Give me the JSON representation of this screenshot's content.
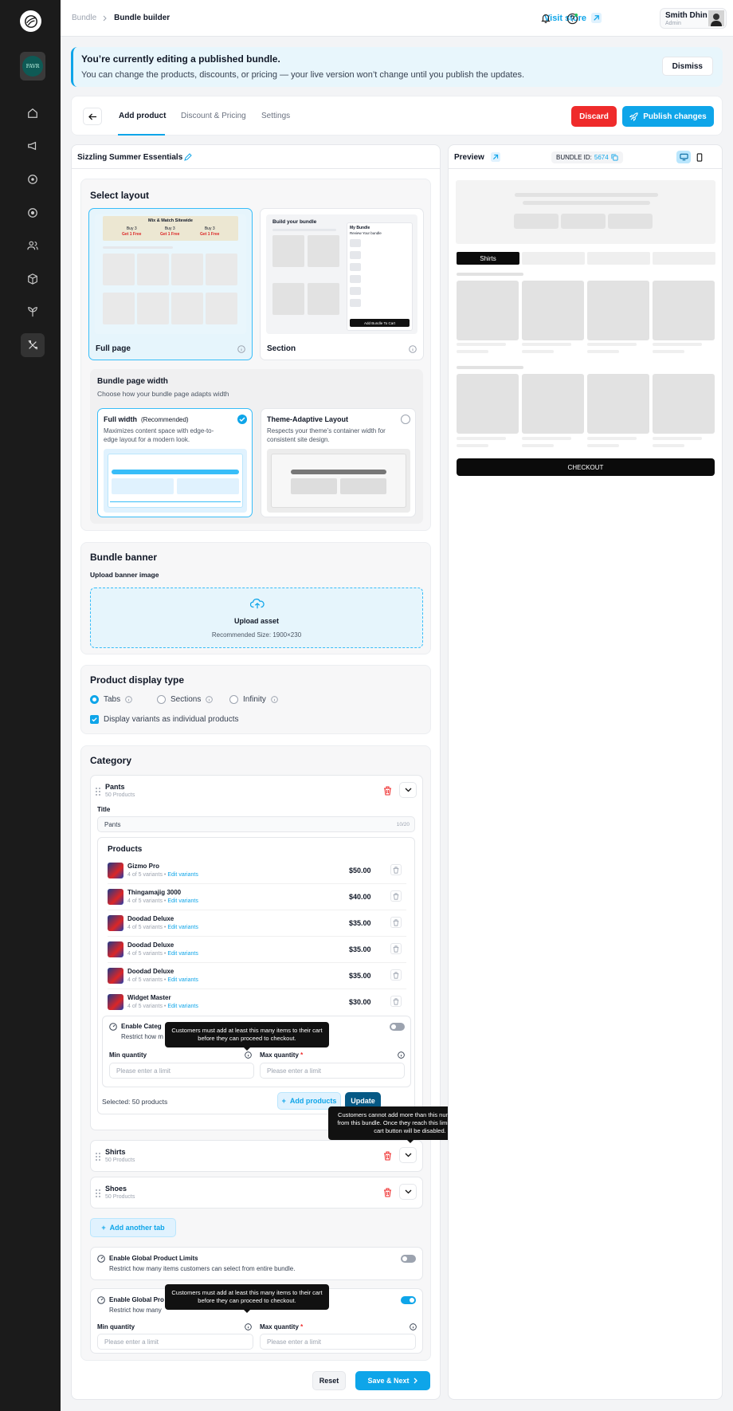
{
  "breadcrumb": {
    "parent": "Bundle",
    "current": "Bundle builder"
  },
  "topbar": {
    "visit_store": "Visit store",
    "user_name": "Smith Dhin",
    "user_role": "Admin"
  },
  "sidebar": {
    "store_badge": "FAVR",
    "items": [
      "home-icon",
      "megaphone-icon",
      "target-icon",
      "circle-dot-icon",
      "users-icon",
      "box-icon",
      "plant-icon",
      "tools-icon"
    ],
    "active_index": 7
  },
  "notice": {
    "title": "You’re currently editing a published bundle.",
    "body": "You can change the products, discounts, or pricing — your live version won’t change until you publish the updates.",
    "dismiss": "Dismiss"
  },
  "tabs": [
    {
      "label": "Add product",
      "active": true
    },
    {
      "label": "Discount & Pricing",
      "active": false
    },
    {
      "label": "Settings",
      "active": false
    }
  ],
  "actions": {
    "discard": "Discard",
    "publish": "Publish changes"
  },
  "bundle_name": "Sizzling Summer Essentials",
  "layout": {
    "heading": "Select layout",
    "full_page": {
      "label": "Full page",
      "banner_title": "Mix & Match Sitewide",
      "offers": [
        {
          "a": "Buy 3",
          "b": "Get 1 Free"
        },
        {
          "a": "Buy 3",
          "b": "Get 1 Free"
        },
        {
          "a": "Buy 3",
          "b": "Get 1 Free"
        }
      ]
    },
    "section": {
      "label": "Section",
      "title": "Build your bundle",
      "side_title": "My Bundle",
      "side_sub": "Review Your bundle",
      "cta": "Add Bundle To Cart"
    }
  },
  "page_width": {
    "heading": "Bundle page width",
    "sub": "Choose how your bundle page adapts width",
    "full": {
      "title": "Full width",
      "tag": "(Recommended)",
      "desc": "Maximizes content space with edge-to-edge layout for a modern look."
    },
    "adaptive": {
      "title": "Theme-Adaptive Layout",
      "desc": "Respects your theme’s container width for consistent site design."
    }
  },
  "banner_section": {
    "heading": "Bundle banner",
    "upload_label": "Upload banner image",
    "upload_title": "Upload asset",
    "upload_hint": "Recommended Size: 1900×230"
  },
  "display_type": {
    "heading": "Product display type",
    "options": [
      "Tabs",
      "Sections",
      "Infinity"
    ],
    "selected": "Tabs",
    "checkbox": "Display variants as individual products"
  },
  "category": {
    "heading": "Category",
    "expanded": {
      "name": "Pants",
      "count": "50 Products",
      "title_label": "Title",
      "title_value": "Pants",
      "title_count": "10/20",
      "products_heading": "Products",
      "products": [
        {
          "name": "Gizmo Pro",
          "variants": "4 of 5 variants",
          "edit": "Edit variants",
          "price": "$50.00"
        },
        {
          "name": "Thingamajig 3000",
          "variants": "4 of 5 variants",
          "edit": "Edit variants",
          "price": "$40.00"
        },
        {
          "name": "Doodad Deluxe",
          "variants": "4 of 5 variants",
          "edit": "Edit variants",
          "price": "$35.00"
        },
        {
          "name": "Doodad Deluxe",
          "variants": "4 of 5 variants",
          "edit": "Edit variants",
          "price": "$35.00"
        },
        {
          "name": "Doodad Deluxe",
          "variants": "4 of 5 variants",
          "edit": "Edit variants",
          "price": "$35.00"
        },
        {
          "name": "Widget Master",
          "variants": "4 of 5 variants",
          "edit": "Edit variants",
          "price": "$30.00"
        }
      ],
      "limit_title": "Enable Categ",
      "limit_sub": "Restrict how m",
      "min_label": "Min quantity",
      "max_label": "Max quantity",
      "placeholder": "Please enter a limit",
      "selected": "Selected:  50 products",
      "add_products": "Add products",
      "update": "Update"
    },
    "collapsed": [
      {
        "name": "Shirts",
        "count": "50 Products"
      },
      {
        "name": "Shoes",
        "count": "50 Products"
      }
    ],
    "add_tab": "Add another tab"
  },
  "global_limits_1": {
    "title": "Enable Global Product Limits",
    "sub": "Restrict how many items customers can select from entire bundle.",
    "enabled": false
  },
  "global_limits_2": {
    "title": "Enable Global Pro",
    "sub": "Restrict how many",
    "enabled": true,
    "min_label": "Min quantity",
    "max_label": "Max quantity",
    "placeholder": "Please enter a limit"
  },
  "tooltips": {
    "min": "Customers must add at least this many items to their cart before they can proceed to checkout.",
    "max": "Customers cannot add more than this number of items from this bundle. Once they reach this limit, the add-to-cart button will be disabled."
  },
  "footer": {
    "reset": "Reset",
    "save": "Save & Next"
  },
  "preview": {
    "title": "Preview",
    "bundle_id_label": "BUNDLE ID:",
    "bundle_id": "5674",
    "active_tab": "Shirts",
    "checkout": "CHECKOUT"
  },
  "colors": {
    "accent": "#0ea5e9",
    "danger": "#ef2b2b",
    "sidebar": "#1b1b1b"
  }
}
